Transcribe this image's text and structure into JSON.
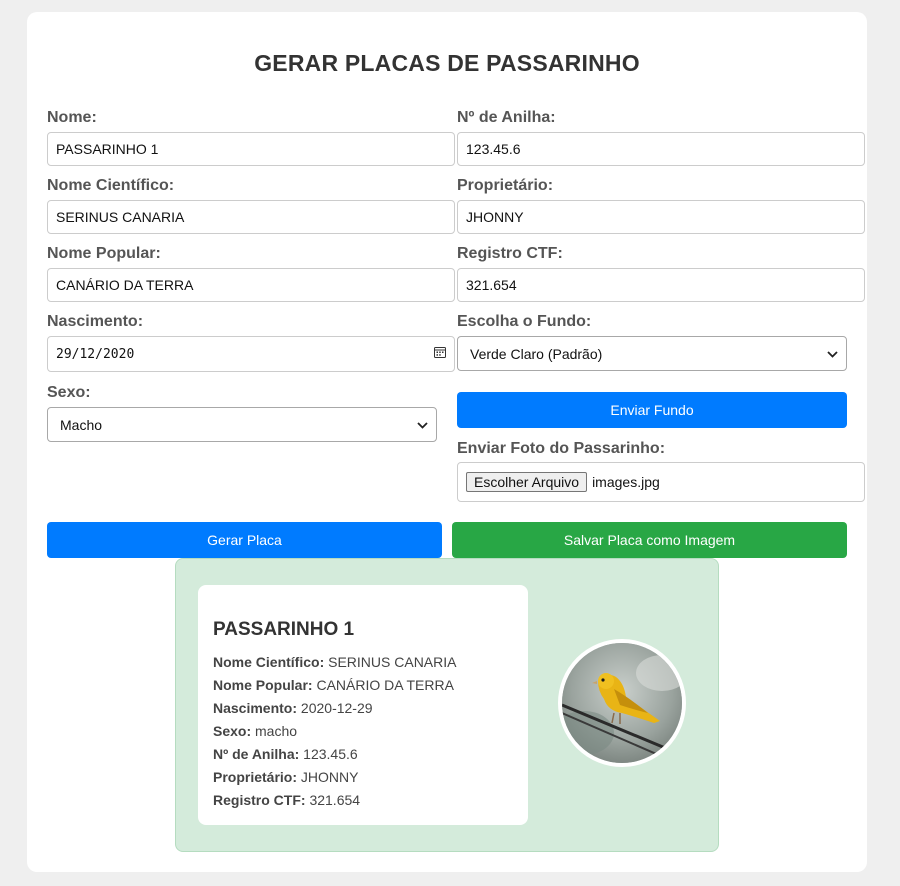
{
  "title": "GERAR PLACAS DE PASSARINHO",
  "form": {
    "nome": {
      "label": "Nome:",
      "value": "PASSARINHO 1"
    },
    "anilha": {
      "label": "Nº de Anilha:",
      "value": "123.45.6"
    },
    "cientifico": {
      "label": "Nome Científico:",
      "value": "SERINUS CANARIA"
    },
    "proprietario": {
      "label": "Proprietário:",
      "value": "JHONNY"
    },
    "popular": {
      "label": "Nome Popular:",
      "value": "CANÁRIO DA TERRA"
    },
    "ctf": {
      "label": "Registro CTF:",
      "value": "321.654"
    },
    "nascimento": {
      "label": "Nascimento:",
      "value": "29/12/2020"
    },
    "fundo": {
      "label": "Escolha o Fundo:",
      "value": "Verde Claro (Padrão)"
    },
    "sexo": {
      "label": "Sexo:",
      "value": "Macho"
    },
    "enviar_fundo": "Enviar Fundo",
    "foto": {
      "label": "Enviar Foto do Passarinho:",
      "button": "Escolher Arquivo",
      "filename": "images.jpg"
    }
  },
  "actions": {
    "gerar": "Gerar Placa",
    "salvar": "Salvar Placa como Imagem"
  },
  "plate": {
    "name": "PASSARINHO 1",
    "rows": [
      {
        "label": "Nome Científico:",
        "value": "SERINUS CANARIA"
      },
      {
        "label": "Nome Popular:",
        "value": "CANÁRIO DA TERRA"
      },
      {
        "label": "Nascimento:",
        "value": "2020-12-29"
      },
      {
        "label": "Sexo:",
        "value": "macho"
      },
      {
        "label": "Nº de Anilha:",
        "value": "123.45.6"
      },
      {
        "label": "Proprietário:",
        "value": "JHONNY"
      },
      {
        "label": "Registro CTF:",
        "value": "321.654"
      }
    ],
    "background_color": "#d4ebdb"
  },
  "colors": {
    "primary": "#007bff",
    "success": "#28a745"
  },
  "icons": {
    "calendar": "calendar-icon",
    "chevron": "chevron-down-icon"
  }
}
